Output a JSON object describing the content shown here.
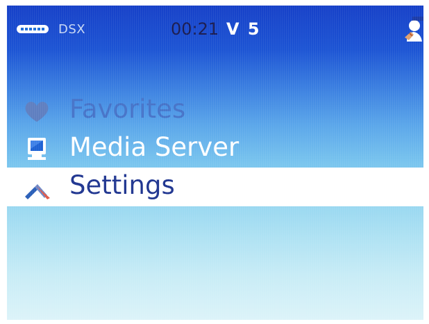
{
  "status_bar": {
    "battery_icon": "battery-icon",
    "device_name": "DSX",
    "time": "00:21",
    "volume": "V 5",
    "user_icon": "user-icon"
  },
  "menu": {
    "items": [
      {
        "label": "Favorites",
        "icon": "heart-icon",
        "state": "faded"
      },
      {
        "label": "Media Server",
        "icon": "monitor-icon",
        "state": "normal"
      },
      {
        "label": "Settings",
        "icon": "settings-icon",
        "state": "selected"
      }
    ]
  },
  "colors": {
    "background_top": "#1640c8",
    "background_bottom": "#dcf3f9",
    "selected_row": "#ffffff",
    "selected_text": "#1f3590",
    "faded_text": "#4673c8",
    "time_text": "#1a1b4f"
  }
}
